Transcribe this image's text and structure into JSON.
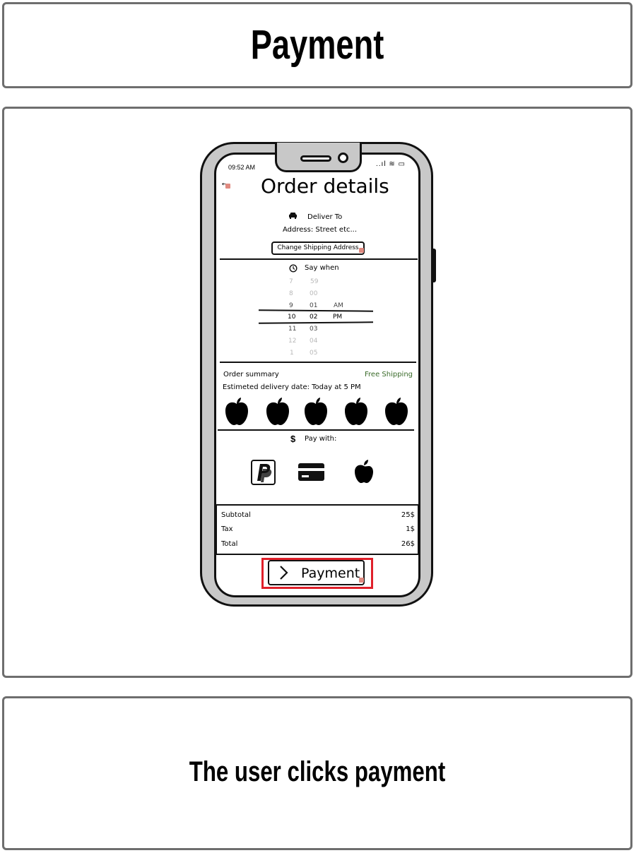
{
  "header": {
    "title": "Payment"
  },
  "caption": {
    "text": "The user clicks payment"
  },
  "phone": {
    "status": {
      "time": "09:52 AM",
      "icons": "..ıl ≋ ▭"
    },
    "back_icon": "←",
    "title": "Order details",
    "deliver": {
      "icon": "car-icon",
      "label": "Deliver To",
      "address": "Address: Street etc...",
      "change_button": "Change Shipping Address"
    },
    "schedule": {
      "icon": "clock-icon",
      "label": "Say when",
      "hours": [
        "7",
        "8",
        "9",
        "10",
        "11",
        "12",
        "1"
      ],
      "minutes": [
        "59",
        "00",
        "01",
        "02",
        "03",
        "04",
        "05"
      ],
      "ampm": [
        "AM",
        "PM"
      ]
    },
    "summary": {
      "label": "Order summary",
      "shipping": "Free Shipping",
      "estimate": "Estimeted delivery date: Today at 5 PM",
      "items": [
        "apple-icon",
        "apple-icon",
        "apple-icon",
        "apple-icon",
        "apple-icon"
      ]
    },
    "payment": {
      "icon": "$",
      "label": "Pay with:",
      "methods": [
        "paypal-icon",
        "credit-card-icon",
        "apple-pay-icon"
      ]
    },
    "totals": [
      {
        "label": "Subtotal",
        "value": "25$"
      },
      {
        "label": "Tax",
        "value": "1$"
      },
      {
        "label": "Total",
        "value": "26$"
      }
    ],
    "pay_button": {
      "chevron": "›",
      "label": "Payment"
    }
  },
  "colors": {
    "highlight": "#e0202a",
    "free_shipping": "#3a6b2a"
  }
}
